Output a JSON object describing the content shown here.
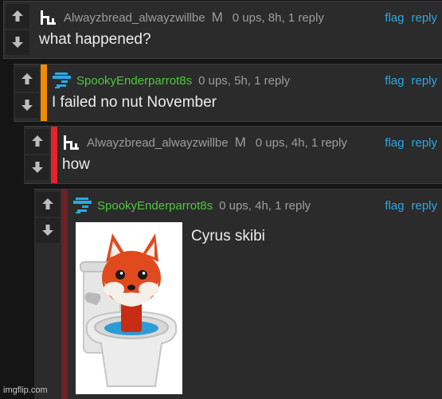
{
  "colors": {
    "accent_link": "#2da7e0",
    "username_green": "#4fc63f",
    "bar_orange": "#f28c00",
    "bar_red": "#e8222a",
    "bar_maroon": "#6a2222"
  },
  "comments": [
    {
      "username": "Alwayzbread_alwayzwillbe",
      "mod_badge": "M",
      "stats": "0 ups, 8h, 1 reply",
      "text": "what happened?",
      "flag_label": "flag",
      "reply_label": "reply",
      "avatar_icon": "pixel-logo-icon"
    },
    {
      "username": "SpookyEnderparrot8s",
      "stats": "0 ups, 5h, 1 reply",
      "text": "I failed no nut November",
      "flag_label": "flag",
      "reply_label": "reply",
      "avatar_icon": "blue-pixel-avatar-icon"
    },
    {
      "username": "Alwayzbread_alwayzwillbe",
      "mod_badge": "M",
      "stats": "0 ups, 4h, 1 reply",
      "text": "how",
      "flag_label": "flag",
      "reply_label": "reply",
      "avatar_icon": "pixel-logo-icon"
    },
    {
      "username": "SpookyEnderparrot8s",
      "stats": "0 ups, 4h, 1 reply",
      "text": "Cyrus skibi",
      "flag_label": "flag",
      "reply_label": "reply",
      "avatar_icon": "blue-pixel-avatar-icon",
      "image_subject": "fox-head-in-toilet"
    }
  ],
  "watermark": "imgflip.com"
}
